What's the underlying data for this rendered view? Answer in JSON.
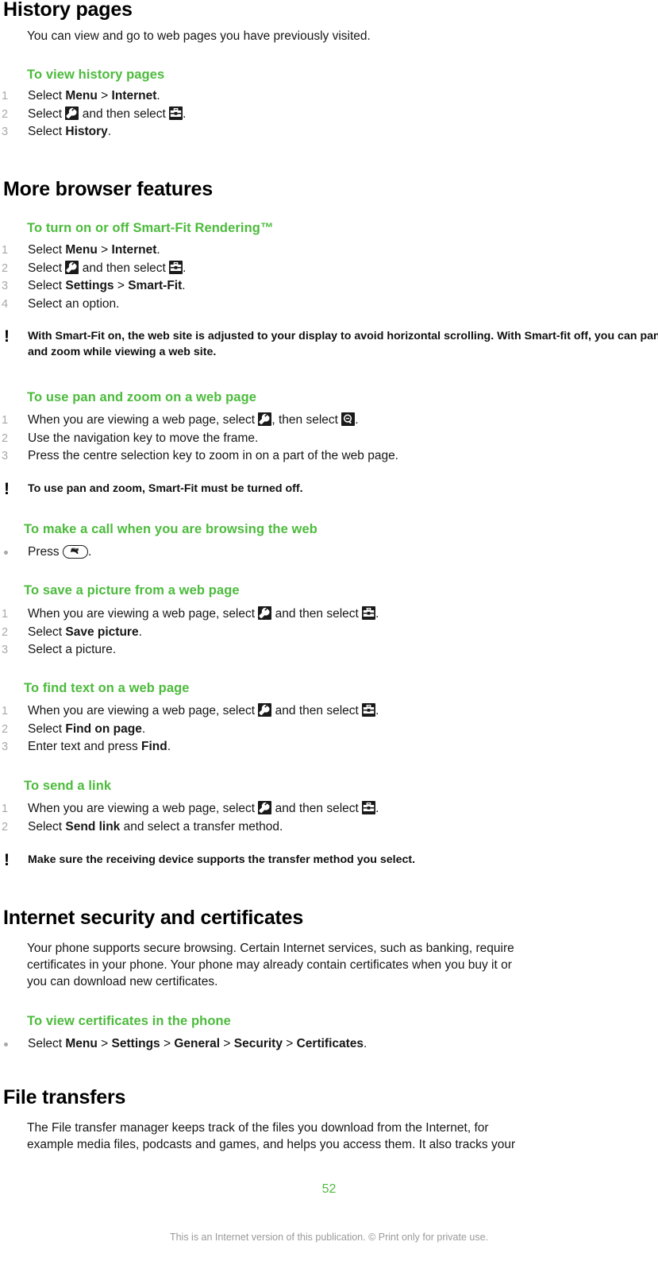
{
  "page": {
    "number": "52",
    "footer_note": "This is an Internet version of this publication. © Print only for private use.",
    "accent_green": "#4cbb3c",
    "text_color": "#161616",
    "step_number_color": "#a8a8a8"
  },
  "sections": [
    {
      "id": "history-pages",
      "heading": "History pages",
      "intro": "You can view and go to web pages you have previously visited.",
      "tasks": [
        {
          "title": "To view history pages",
          "steps": [
            {
              "num": "1",
              "parts": [
                {
                  "t": "text",
                  "v": "Select "
                },
                {
                  "t": "bold",
                  "v": "Menu"
                },
                {
                  "t": "text",
                  "v": " > "
                },
                {
                  "t": "bold",
                  "v": "Internet"
                },
                {
                  "t": "text",
                  "v": "."
                }
              ]
            },
            {
              "num": "2",
              "parts": [
                {
                  "t": "text",
                  "v": "Select "
                },
                {
                  "t": "icon",
                  "v": "wrench-icon"
                },
                {
                  "t": "text",
                  "v": " and then select "
                },
                {
                  "t": "icon",
                  "v": "toolbox-icon"
                },
                {
                  "t": "text",
                  "v": "."
                }
              ]
            },
            {
              "num": "3",
              "parts": [
                {
                  "t": "text",
                  "v": "Select "
                },
                {
                  "t": "bold",
                  "v": "History"
                },
                {
                  "t": "text",
                  "v": "."
                }
              ]
            }
          ]
        }
      ]
    },
    {
      "id": "more-browser-features",
      "heading": "More browser features",
      "tasks": [
        {
          "title": "To turn on or off Smart-Fit Rendering™",
          "steps": [
            {
              "num": "1",
              "parts": [
                {
                  "t": "text",
                  "v": "Select "
                },
                {
                  "t": "bold",
                  "v": "Menu"
                },
                {
                  "t": "text",
                  "v": " > "
                },
                {
                  "t": "bold",
                  "v": "Internet"
                },
                {
                  "t": "text",
                  "v": "."
                }
              ]
            },
            {
              "num": "2",
              "parts": [
                {
                  "t": "text",
                  "v": "Select "
                },
                {
                  "t": "icon",
                  "v": "wrench-icon"
                },
                {
                  "t": "text",
                  "v": " and then select "
                },
                {
                  "t": "icon",
                  "v": "toolbox-icon"
                },
                {
                  "t": "text",
                  "v": "."
                }
              ]
            },
            {
              "num": "3",
              "parts": [
                {
                  "t": "text",
                  "v": "Select "
                },
                {
                  "t": "bold",
                  "v": "Settings"
                },
                {
                  "t": "text",
                  "v": " > "
                },
                {
                  "t": "bold",
                  "v": "Smart-Fit"
                },
                {
                  "t": "text",
                  "v": "."
                }
              ]
            },
            {
              "num": "4",
              "parts": [
                {
                  "t": "text",
                  "v": "Select an option."
                }
              ]
            }
          ],
          "note": "With Smart-Fit on, the web site is adjusted to your display to avoid horizontal scrolling. With Smart-fit off, you can pan and zoom while viewing a web site."
        },
        {
          "title": "To use pan and zoom on a web page",
          "steps": [
            {
              "num": "1",
              "parts": [
                {
                  "t": "text",
                  "v": "When you are viewing a web page, select "
                },
                {
                  "t": "icon",
                  "v": "wrench-icon"
                },
                {
                  "t": "text",
                  "v": ", then select "
                },
                {
                  "t": "icon",
                  "v": "zoom-icon"
                },
                {
                  "t": "text",
                  "v": "."
                }
              ]
            },
            {
              "num": "2",
              "parts": [
                {
                  "t": "text",
                  "v": "Use the navigation key to move the frame."
                }
              ]
            },
            {
              "num": "3",
              "parts": [
                {
                  "t": "text",
                  "v": "Press the centre selection key to zoom in on a part of the web page."
                }
              ]
            }
          ],
          "note_parts": [
            {
              "t": "text",
              "v": "To use pan and zoom, "
            },
            {
              "t": "bold",
              "v": "Smart-Fit"
            },
            {
              "t": "text",
              "v": " must be turned off."
            }
          ]
        },
        {
          "title": "To make a call when you are browsing the web",
          "steps": [
            {
              "num": "•",
              "parts": [
                {
                  "t": "text",
                  "v": "Press "
                },
                {
                  "t": "icon",
                  "v": "call-key-icon"
                },
                {
                  "t": "text",
                  "v": "."
                }
              ]
            }
          ]
        },
        {
          "title": "To save a picture from a web page",
          "steps": [
            {
              "num": "1",
              "parts": [
                {
                  "t": "text",
                  "v": "When you are viewing a web page, select "
                },
                {
                  "t": "icon",
                  "v": "wrench-icon"
                },
                {
                  "t": "text",
                  "v": " and then select "
                },
                {
                  "t": "icon",
                  "v": "toolbox-icon"
                },
                {
                  "t": "text",
                  "v": "."
                }
              ]
            },
            {
              "num": "2",
              "parts": [
                {
                  "t": "text",
                  "v": "Select "
                },
                {
                  "t": "bold",
                  "v": "Save picture"
                },
                {
                  "t": "text",
                  "v": "."
                }
              ]
            },
            {
              "num": "3",
              "parts": [
                {
                  "t": "text",
                  "v": "Select a picture."
                }
              ]
            }
          ]
        },
        {
          "title": "To find text on a web page",
          "steps": [
            {
              "num": "1",
              "parts": [
                {
                  "t": "text",
                  "v": "When you are viewing a web page, select "
                },
                {
                  "t": "icon",
                  "v": "wrench-icon"
                },
                {
                  "t": "text",
                  "v": " and then select "
                },
                {
                  "t": "icon",
                  "v": "toolbox-icon"
                },
                {
                  "t": "text",
                  "v": "."
                }
              ]
            },
            {
              "num": "2",
              "parts": [
                {
                  "t": "text",
                  "v": "Select "
                },
                {
                  "t": "bold",
                  "v": "Find on page"
                },
                {
                  "t": "text",
                  "v": "."
                }
              ]
            },
            {
              "num": "3",
              "parts": [
                {
                  "t": "text",
                  "v": "Enter text and press "
                },
                {
                  "t": "bold",
                  "v": "Find"
                },
                {
                  "t": "text",
                  "v": "."
                }
              ]
            }
          ]
        },
        {
          "title": "To send a link",
          "steps": [
            {
              "num": "1",
              "parts": [
                {
                  "t": "text",
                  "v": "When you are viewing a web page, select "
                },
                {
                  "t": "icon",
                  "v": "wrench-icon"
                },
                {
                  "t": "text",
                  "v": " and then select "
                },
                {
                  "t": "icon",
                  "v": "toolbox-icon"
                },
                {
                  "t": "text",
                  "v": "."
                }
              ]
            },
            {
              "num": "2",
              "parts": [
                {
                  "t": "text",
                  "v": "Select "
                },
                {
                  "t": "bold",
                  "v": "Send link"
                },
                {
                  "t": "text",
                  "v": " and select a transfer method."
                }
              ]
            }
          ],
          "note": "Make sure the receiving device supports the transfer method you select."
        }
      ]
    },
    {
      "id": "internet-security",
      "heading": "Internet security and certificates",
      "intro": "Your phone supports secure browsing. Certain Internet services, such as banking, require certificates in your phone. Your phone may already contain certificates when you buy it or you can download new certificates.",
      "tasks": [
        {
          "title": "To view certificates in the phone",
          "steps": [
            {
              "num": "•",
              "parts": [
                {
                  "t": "text",
                  "v": "Select "
                },
                {
                  "t": "bold",
                  "v": "Menu"
                },
                {
                  "t": "text",
                  "v": " > "
                },
                {
                  "t": "bold",
                  "v": "Settings"
                },
                {
                  "t": "text",
                  "v": " > "
                },
                {
                  "t": "bold",
                  "v": "General"
                },
                {
                  "t": "text",
                  "v": " > "
                },
                {
                  "t": "bold",
                  "v": "Security"
                },
                {
                  "t": "text",
                  "v": " > "
                },
                {
                  "t": "bold",
                  "v": "Certificates"
                },
                {
                  "t": "text",
                  "v": "."
                }
              ]
            }
          ]
        }
      ]
    },
    {
      "id": "file-transfers",
      "heading": "File transfers",
      "intro": "The File transfer manager keeps track of the files you download from the Internet, for example media files, podcasts and games, and helps you access them. It also tracks your"
    }
  ],
  "text": {
    "h_history": "History pages",
    "p_history_intro": "You can view and go to web pages you have previously visited.",
    "t_view_history": "To view history pages",
    "h_more": "More browser features",
    "t_smartfit": "To turn on or off Smart-Fit Rendering™",
    "t_smartfit_s4": "Select an option.",
    "note_smartfit": "With Smart-Fit on, the web site is adjusted to your display to avoid horizontal scrolling. With Smart-fit off, you can pan and zoom while viewing a web site.",
    "t_panzoom": "To use pan and zoom on a web page",
    "panzoom_s2": "Use the navigation key to move the frame.",
    "panzoom_s3": "Press the centre selection key to zoom in on a part of the web page.",
    "t_call": "To make a call when you are browsing the web",
    "t_savepic": "To save a picture from a web page",
    "savepic_s3": "Select a picture.",
    "t_findtext": "To find text on a web page",
    "t_sendlink": "To send a link",
    "note_sendlink": "Make sure the receiving device supports the transfer method you select.",
    "h_security": "Internet security and certificates",
    "p_security_l1": "Your phone supports secure browsing. Certain Internet services, such as banking, require",
    "p_security_l2": "certificates in your phone. Your phone may already contain certificates when you buy it or",
    "p_security_l3": "you can download new certificates.",
    "t_viewcert": "To view certificates in the phone",
    "h_filetransfers": "File transfers",
    "p_filetransfers_l1": "The File transfer manager keeps track of the files you download from the Internet, for",
    "p_filetransfers_l2": "example media files, podcasts and games, and helps you access them. It also tracks your",
    "lbl_select": "Select ",
    "lbl_when_viewing": "When you are viewing a web page, select ",
    "lbl_and_then_select": " and then select ",
    "lbl_then_select": ", then select ",
    "lbl_press": "Press ",
    "lbl_enter_text_press": "Enter text and press ",
    "lbl_gt": " > ",
    "lbl_period": ".",
    "b_menu": "Menu",
    "b_internet": "Internet",
    "b_history": "History",
    "b_settings": "Settings",
    "b_smartfit": "Smart-Fit",
    "b_savepicture": "Save picture",
    "b_findonpage": "Find on page",
    "b_find": "Find",
    "b_sendlink": "Send link",
    "b_general": "General",
    "b_security": "Security",
    "b_certificates": "Certificates",
    "note_panzoom_a": "To use pan and zoom, ",
    "note_panzoom_b": " must be turned off.",
    "sendlink_s2_tail": " and select a transfer method.",
    "n1": "1",
    "n2": "2",
    "n3": "3",
    "n4": "4",
    "page_number": "52",
    "footer": "This is an Internet version of this publication. © Print only for private use."
  }
}
